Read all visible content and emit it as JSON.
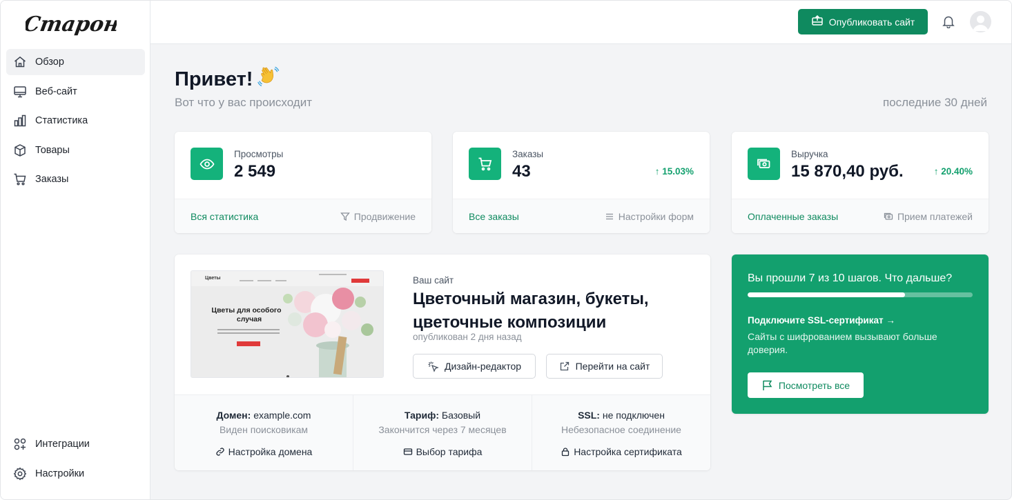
{
  "app": {
    "brand": "Старонка"
  },
  "sidebar": {
    "items": [
      {
        "label": "Обзор",
        "icon": "home-icon",
        "active": true
      },
      {
        "label": "Веб-сайт",
        "icon": "monitor-icon"
      },
      {
        "label": "Статистика",
        "icon": "bar-chart-icon"
      },
      {
        "label": "Товары",
        "icon": "box-icon"
      },
      {
        "label": "Заказы",
        "icon": "cart-icon"
      }
    ],
    "bottom_items": [
      {
        "label": "Интеграции",
        "icon": "integrations-icon"
      },
      {
        "label": "Настройки",
        "icon": "gear-icon"
      }
    ]
  },
  "header": {
    "publish_label": "Опубликовать сайт"
  },
  "main": {
    "greeting": "Привет!",
    "subtitle": "Вот что у вас происходит",
    "period": "последние 30 дней"
  },
  "stats": [
    {
      "label": "Просмотры",
      "value": "2 549",
      "change": "",
      "link": "Вся статистика",
      "secondary": "Продвижение"
    },
    {
      "label": "Заказы",
      "value": "43",
      "change": "↑ 15.03%",
      "link": "Все заказы",
      "secondary": "Настройки форм"
    },
    {
      "label": "Выручка",
      "value": "15 870,40 руб.",
      "change": "↑ 20.40%",
      "link": "Оплаченные заказы",
      "secondary": "Прием платежей"
    }
  ],
  "site": {
    "kicker": "Ваш сайт",
    "title": "Цветочный магазин, букеты, цветочные композиции",
    "published": "опубликован 2 дня назад",
    "design_btn": "Дизайн-редактор",
    "goto_btn": "Перейти на сайт",
    "thumb": {
      "brand": "Цветы",
      "heading": "Цветы для особого случая"
    },
    "domain": {
      "label": "Домен:",
      "value": "example.com",
      "sub": "Виден поисковикам",
      "link": "Настройка домена"
    },
    "plan": {
      "label": "Тариф:",
      "value": "Базовый",
      "sub": "Закончится через 7 месяцев",
      "link": "Выбор тарифа"
    },
    "ssl": {
      "label": "SSL:",
      "value": "не подключен",
      "sub": "Небезопасное соединение",
      "link": "Настройка сертификата"
    }
  },
  "steps": {
    "title": "Вы прошли 7 из 10 шагов. Что дальше?",
    "progress": 0.7,
    "link": "Подключите SSL-сертификат →",
    "desc": "Сайты с шифрованием вызывают больше доверия.",
    "button": "Посмотреть все"
  },
  "colors": {
    "accent": "#0f8a5f",
    "accent_light": "#14b27b",
    "steps_bg": "#13a06e"
  }
}
